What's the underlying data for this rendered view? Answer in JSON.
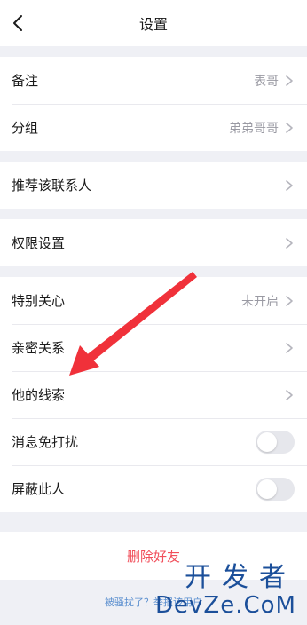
{
  "header": {
    "title": "设置"
  },
  "groups": {
    "info": [
      {
        "label": "备注",
        "value": "表哥"
      },
      {
        "label": "分组",
        "value": "弟弟哥哥"
      }
    ],
    "recommend": {
      "label": "推荐该联系人"
    },
    "permission": {
      "label": "权限设置"
    },
    "relation": [
      {
        "label": "特别关心",
        "value": "未开启"
      },
      {
        "label": "亲密关系"
      },
      {
        "label": "他的线索"
      }
    ],
    "toggles": [
      {
        "label": "消息免打扰",
        "state": "off"
      },
      {
        "label": "屏蔽此人",
        "state": "off"
      }
    ]
  },
  "footer": {
    "delete_label": "删除好友",
    "report_text": "被骚扰了？举报该用户"
  },
  "watermark": {
    "line1": "开发者",
    "line2": "DevZe.CoM"
  },
  "colors": {
    "delete": "#f14f5b",
    "link": "#5b8fcf",
    "annotation_arrow": "#f0313a"
  }
}
